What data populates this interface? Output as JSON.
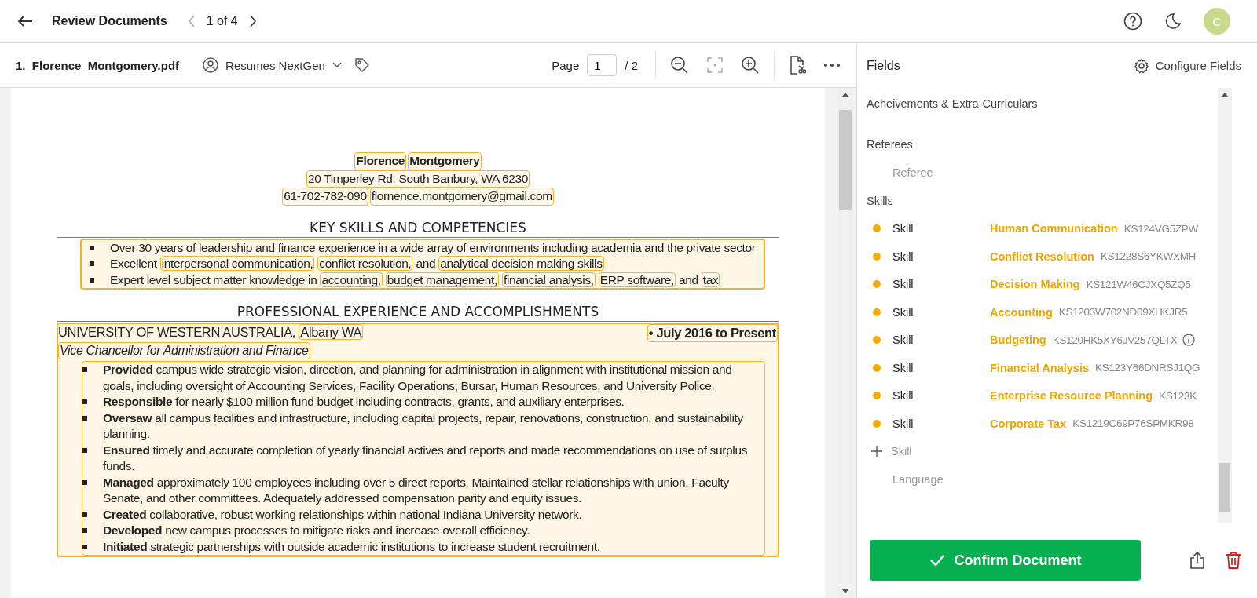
{
  "header": {
    "title": "Review Documents",
    "pager": "1 of 4",
    "avatar": "C"
  },
  "toolbar": {
    "filename": "1._Florence_Montgomery.pdf",
    "doc_type": "Resumes NextGen",
    "page_label": "Page",
    "page": "1",
    "page_total": "/ 2"
  },
  "resume": {
    "header_lines": [
      {
        "kind": "name",
        "segments": [
          {
            "text": "Florence",
            "highlighted": true
          },
          {
            "text": "Montgomery",
            "highlighted": true
          }
        ]
      },
      {
        "kind": "plain",
        "segments": [
          {
            "text": "20 Timperley Rd. South Banbury, WA 6230",
            "highlighted": true
          }
        ]
      },
      {
        "kind": "plain",
        "segments": [
          {
            "text": "61-702-782-090",
            "highlighted": true
          },
          {
            "text": "flornence.montgomery@gmail.com",
            "highlighted": true
          }
        ]
      }
    ],
    "sections": [
      {
        "heading": "KEY SKILLS AND COMPETENCIES",
        "blocks": [
          {
            "kind": "bullets",
            "highlighted": true,
            "bullets": [
              [
                {
                  "text": "Over 30 years of leadership and finance experience in a wide array of environments including academia and the private sector",
                  "highlighted": false
                }
              ],
              [
                {
                  "text": "Excellent",
                  "highlighted": false
                },
                {
                  "text": "interpersonal communication,",
                  "highlighted": true
                },
                {
                  "text": "conflict resolution,",
                  "highlighted": true
                },
                {
                  "text": "and",
                  "highlighted": false
                },
                {
                  "text": "analytical decision making skills",
                  "highlighted": true
                }
              ],
              [
                {
                  "text": "Expert level subject matter knowledge in",
                  "highlighted": false
                },
                {
                  "text": "accounting,",
                  "highlighted": true
                },
                {
                  "text": "budget management,",
                  "highlighted": true
                },
                {
                  "text": "financial analysis,",
                  "highlighted": true
                },
                {
                  "text": "ERP software,",
                  "highlighted": true
                },
                {
                  "text": "and",
                  "highlighted": false
                },
                {
                  "text": "tax",
                  "highlighted": true
                }
              ]
            ]
          }
        ]
      },
      {
        "heading": "PROFESSIONAL EXPERIENCE AND ACCOMPLISHMENTS",
        "blocks": [
          {
            "kind": "job",
            "highlighted": true,
            "org": [
              {
                "text": "UNIVERSITY OF WESTERN AUSTRALIA,",
                "highlighted": false
              },
              {
                "text": "Albany WA",
                "highlighted": true
              }
            ],
            "date": {
              "text": "• July 2016 to Present",
              "highlighted": true
            },
            "title": {
              "text": "Vice Chancellor for Administration and Finance",
              "highlighted": true
            },
            "bullets_highlighted": true,
            "bullets": [
              "**Provided** campus wide strategic vision, direction, and planning for administration in alignment with institutional mission and goals, including oversight of Accounting Services, Facility Operations, Bursar, Human Resources, and University Police.",
              "**Responsible** for nearly $100 million fund budget including contracts, grants, and auxiliary enterprises.",
              "**Oversaw** all campus facilities and infrastructure, including capital projects, repair, renovations, construction, and sustainability planning.",
              "**Ensured** timely and accurate completion of yearly financial actives and reports and made recommendations on use of surplus funds.",
              "**Managed** approximately 100 employees including over 5 direct reports. Maintained stellar relationships with union, Faculty Senate, and other committees. Adequately addressed compensation parity and equity issues.",
              "**Created** collaborative, robust working relationships within national Indiana University network.",
              "**Developed** new campus processes to mitigate risks and increase overall efficiency.",
              "**Initiated** strategic partnerships with outside academic institutions to increase student recruitment."
            ]
          }
        ]
      }
    ]
  },
  "fields": {
    "title": "Fields",
    "configure": "Configure Fields",
    "sections": [
      {
        "title": "Acheivements & Extra-Curriculars"
      },
      {
        "title": "Referees",
        "items": [
          {
            "kind": "empty",
            "label": "Referee"
          }
        ]
      },
      {
        "title": "Skills",
        "items": [
          {
            "kind": "value",
            "label": "Skill",
            "value": "Human Communication",
            "code": "KS124VG5ZPW",
            "info": false
          },
          {
            "kind": "value",
            "label": "Skill",
            "value": "Conflict Resolution",
            "code": "KS1228S6YKWXMH",
            "info": false
          },
          {
            "kind": "value",
            "label": "Skill",
            "value": "Decision Making",
            "code": "KS121W46CJXQ5ZQ5",
            "info": false
          },
          {
            "kind": "value",
            "label": "Skill",
            "value": "Accounting",
            "code": "KS1203W702ND09XHKJR5",
            "info": false
          },
          {
            "kind": "value",
            "label": "Skill",
            "value": "Budgeting",
            "code": "KS120HK5XY6JV257QLTX",
            "info": true
          },
          {
            "kind": "value",
            "label": "Skill",
            "value": "Financial Analysis",
            "code": "KS123Y66DNRSJ1QG",
            "info": false
          },
          {
            "kind": "value",
            "label": "Skill",
            "value": "Enterprise Resource Planning",
            "code": "KS123K",
            "info": false
          },
          {
            "kind": "value",
            "label": "Skill",
            "value": "Corporate Tax",
            "code": "KS1219C69P76SPMKR98",
            "info": false
          },
          {
            "kind": "add",
            "label": "Skill"
          },
          {
            "kind": "empty",
            "label": "Language"
          }
        ]
      }
    ]
  },
  "actions": {
    "confirm": "Confirm Document"
  }
}
